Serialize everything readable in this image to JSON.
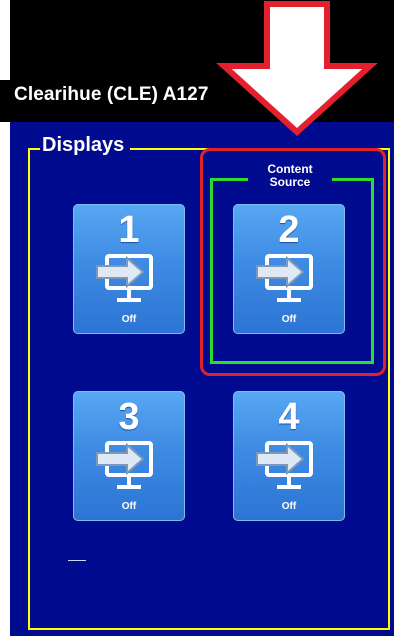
{
  "header": {
    "room_title": "Clearihue (CLE) A127"
  },
  "group": {
    "label": "Displays"
  },
  "content_source": {
    "label": "Content Source"
  },
  "displays": [
    {
      "number": "1",
      "status": "Off"
    },
    {
      "number": "2",
      "status": "Off"
    },
    {
      "number": "3",
      "status": "Off"
    },
    {
      "number": "4",
      "status": "Off"
    }
  ],
  "colors": {
    "background_panel": "#000b8f",
    "frame": "#ffff00",
    "highlight_red": "#e4202f",
    "highlight_green": "#2cdc2c",
    "button_blue": "#3e8be3"
  }
}
